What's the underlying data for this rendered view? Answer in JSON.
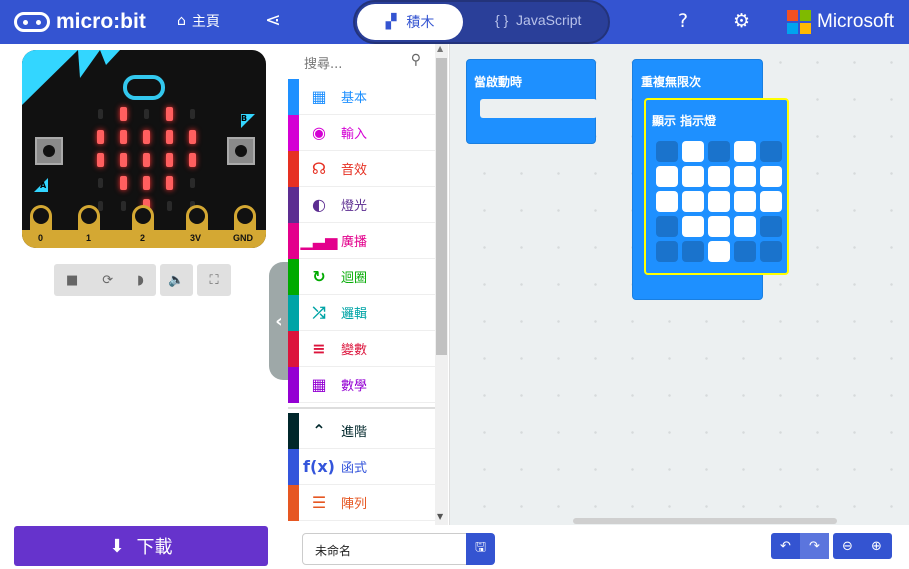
{
  "header": {
    "brand": "micro:bit",
    "home": "主頁",
    "tab_blocks": "積木",
    "tab_js": "JavaScript",
    "tab_js_icon": "{ }",
    "microsoft": "Microsoft"
  },
  "simulator": {
    "pins": [
      "0",
      "1",
      "2",
      "3V",
      "GND"
    ],
    "button_a": "A",
    "button_b": "B",
    "leds": [
      [
        0,
        1,
        0,
        1,
        0
      ],
      [
        1,
        1,
        1,
        1,
        1
      ],
      [
        1,
        1,
        1,
        1,
        1
      ],
      [
        0,
        1,
        1,
        1,
        0
      ],
      [
        0,
        0,
        1,
        0,
        0
      ]
    ]
  },
  "download": "下載",
  "toolbox": {
    "search_placeholder": "搜尋...",
    "categories": [
      {
        "label": "基本",
        "color": "#1e90ff",
        "icon": "▦"
      },
      {
        "label": "輸入",
        "color": "#d400d4",
        "icon": "◉"
      },
      {
        "label": "音效",
        "color": "#e63022",
        "icon": "☊"
      },
      {
        "label": "燈光",
        "color": "#5c2d91",
        "icon": "◐"
      },
      {
        "label": "廣播",
        "color": "#e3008c",
        "icon": "▁▃▅"
      },
      {
        "label": "迴圈",
        "color": "#00aa00",
        "icon": "↻"
      },
      {
        "label": "邏輯",
        "color": "#00a4a6",
        "icon": "⤮"
      },
      {
        "label": "變數",
        "color": "#dc143c",
        "icon": "≡"
      },
      {
        "label": "數學",
        "color": "#9400d3",
        "icon": "▦"
      }
    ],
    "advanced": [
      {
        "label": "進階",
        "color": "#00272b",
        "icon": "⌃"
      },
      {
        "label": "函式",
        "color": "#3455db",
        "icon": "f(x)"
      },
      {
        "label": "陣列",
        "color": "#e65722",
        "icon": "☰"
      }
    ]
  },
  "workspace": {
    "on_start": "當啟動時",
    "forever": "重複無限次",
    "show_leds": "顯示 指示燈",
    "leds": [
      [
        0,
        1,
        0,
        1,
        0
      ],
      [
        1,
        1,
        1,
        1,
        1
      ],
      [
        1,
        1,
        1,
        1,
        1
      ],
      [
        0,
        1,
        1,
        1,
        0
      ],
      [
        0,
        0,
        1,
        0,
        0
      ]
    ]
  },
  "project_name": "未命名"
}
